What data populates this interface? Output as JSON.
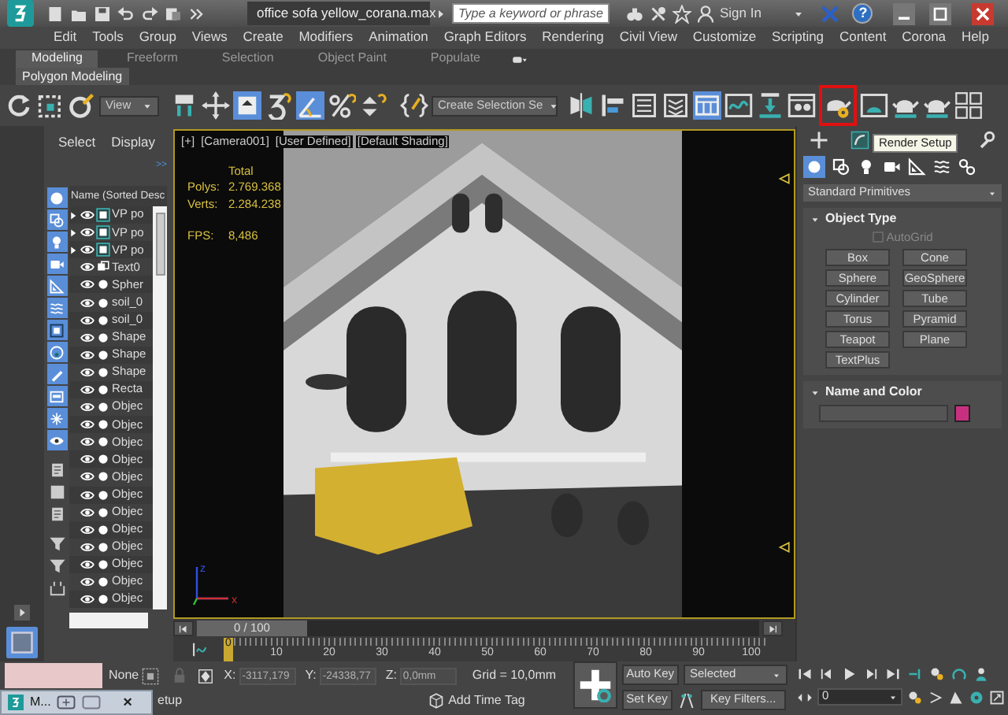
{
  "title_bar": {
    "filename": "office sofa yellow_corana.max",
    "search": {
      "placeholder": "Type a keyword or phrase"
    },
    "sign_in": "Sign In",
    "help": "?"
  },
  "menu": [
    "Edit",
    "Tools",
    "Group",
    "Views",
    "Create",
    "Modifiers",
    "Animation",
    "Graph Editors",
    "Rendering",
    "Civil View",
    "Customize",
    "Scripting",
    "Content",
    "Corona",
    "Help"
  ],
  "ribbon": {
    "tabs": [
      {
        "label": "Modeling",
        "selected": true
      },
      {
        "label": "Freeform",
        "selected": false
      },
      {
        "label": "Selection",
        "selected": false
      },
      {
        "label": "Object Paint",
        "selected": false
      },
      {
        "label": "Populate",
        "selected": false
      }
    ],
    "panel": "Polygon Modeling"
  },
  "toolbar": {
    "view_dropdown": "View",
    "selection_set": "Create Selection Se",
    "render_setup_highlighted": true
  },
  "scene_explorer": {
    "tabs": [
      "Select",
      "Display"
    ],
    "more": ">>",
    "column": "Name (Sorted Desc",
    "rows": [
      {
        "name": "VP po",
        "kind": "group",
        "expandable": true
      },
      {
        "name": "VP po",
        "kind": "group",
        "expandable": true
      },
      {
        "name": "VP po",
        "kind": "group",
        "expandable": true
      },
      {
        "name": "Text0",
        "kind": "shape",
        "expandable": false
      },
      {
        "name": "Spher",
        "kind": "object",
        "expandable": false
      },
      {
        "name": "soil_0",
        "kind": "object",
        "expandable": false
      },
      {
        "name": "soil_0",
        "kind": "object",
        "expandable": false
      },
      {
        "name": "Shape",
        "kind": "object",
        "expandable": false
      },
      {
        "name": "Shape",
        "kind": "object",
        "expandable": false
      },
      {
        "name": "Shape",
        "kind": "object",
        "expandable": false
      },
      {
        "name": "Recta",
        "kind": "object",
        "expandable": false
      },
      {
        "name": "Objec",
        "kind": "object",
        "expandable": false
      },
      {
        "name": "Objec",
        "kind": "object",
        "expandable": false
      },
      {
        "name": "Objec",
        "kind": "object",
        "expandable": false
      },
      {
        "name": "Objec",
        "kind": "object",
        "expandable": false
      },
      {
        "name": "Objec",
        "kind": "object",
        "expandable": false
      },
      {
        "name": "Objec",
        "kind": "object",
        "expandable": false
      },
      {
        "name": "Objec",
        "kind": "object",
        "expandable": false
      },
      {
        "name": "Objec",
        "kind": "object",
        "expandable": false
      },
      {
        "name": "Objec",
        "kind": "object",
        "expandable": false
      },
      {
        "name": "Objec",
        "kind": "object",
        "expandable": false
      },
      {
        "name": "Objec",
        "kind": "object",
        "expandable": false
      },
      {
        "name": "Objec",
        "kind": "object",
        "expandable": false
      }
    ]
  },
  "viewport": {
    "labels": [
      "[+]",
      "[Camera001]",
      "[User Defined]",
      "[Default Shading]"
    ],
    "stats_heading": "Total",
    "stats": [
      {
        "label": "Polys:",
        "value": "2.769.368"
      },
      {
        "label": "Verts:",
        "value": "2.284.238"
      },
      {
        "label": "FPS:",
        "value": "8,486"
      }
    ],
    "axis_labels": [
      "z",
      "x"
    ]
  },
  "command_panel": {
    "tooltip": "Render Setup",
    "category": "Standard Primitives",
    "object_type": {
      "title": "Object Type",
      "autogrid": {
        "label": "AutoGrid",
        "checked": false,
        "disabled": true
      },
      "buttons": [
        "Box",
        "Cone",
        "Sphere",
        "GeoSphere",
        "Cylinder",
        "Tube",
        "Torus",
        "Pyramid",
        "Teapot",
        "Plane",
        "TextPlus"
      ]
    },
    "name_and_color": {
      "title": "Name and Color",
      "color": "#c8307f"
    }
  },
  "time_slider": {
    "label": "0 / 100",
    "level": 0,
    "ticks": [
      "0",
      "10",
      "20",
      "30",
      "40",
      "50",
      "60",
      "70",
      "80",
      "90",
      "100"
    ]
  },
  "status_bar": {
    "selection": "None",
    "coords": [
      {
        "label": "X:",
        "value": "-3117,179"
      },
      {
        "label": "Y:",
        "value": "-24338,77"
      },
      {
        "label": "Z:",
        "value": "0,0mm"
      }
    ],
    "grid": "Grid = 10,0mm",
    "prompt": "etup",
    "time_tag": "Add Time Tag",
    "auto_key": "Auto Key",
    "set_key": "Set Key",
    "key_mode": "Selected",
    "key_filters": "Key Filters...",
    "frame": "0"
  },
  "taskbar_preview": {
    "label": "M...",
    "close": "×"
  }
}
